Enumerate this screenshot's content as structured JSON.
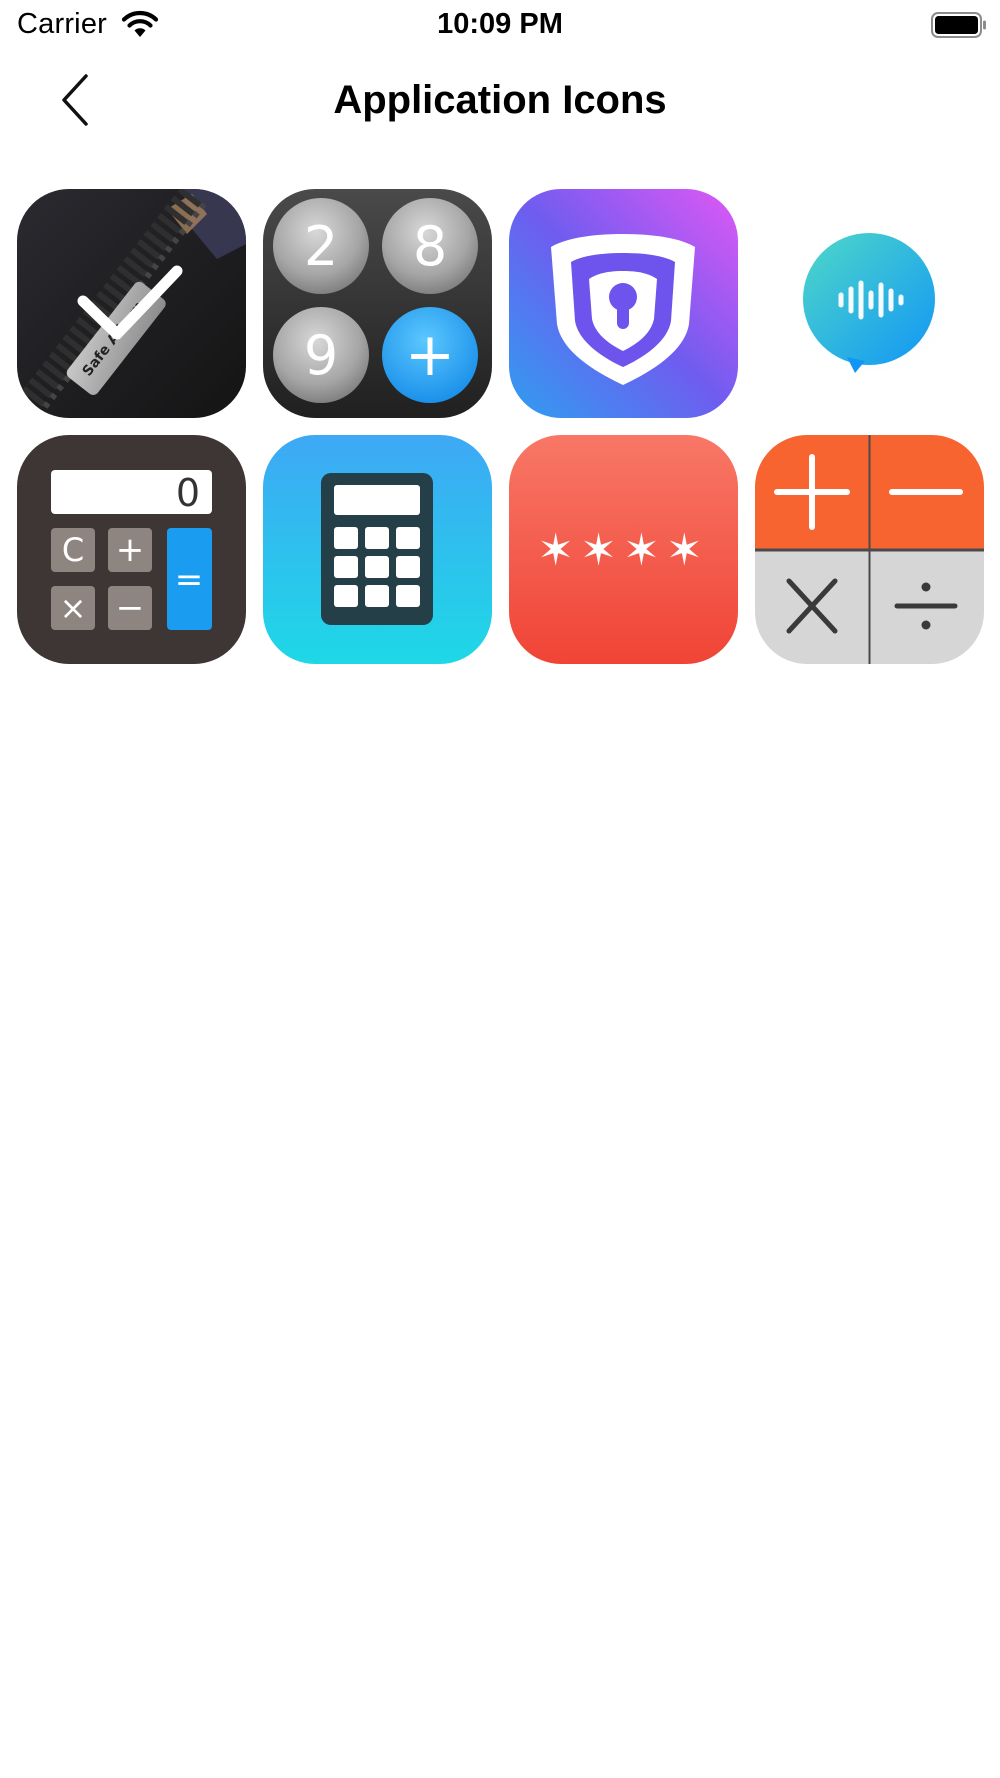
{
  "status_bar": {
    "carrier": "Carrier",
    "time": "10:09 PM"
  },
  "nav": {
    "title": "Application Icons",
    "back_icon": "chevron-left-icon"
  },
  "icons": [
    {
      "name": "safe-album-app-icon",
      "label_text": "Safe Album",
      "selected": true
    },
    {
      "name": "number-keys-app-icon",
      "keys": [
        "2",
        "8",
        "9",
        "+"
      ]
    },
    {
      "name": "shield-lock-app-icon"
    },
    {
      "name": "voice-bubble-app-icon"
    },
    {
      "name": "calculator-display-app-icon",
      "display": "0",
      "keys": [
        "C",
        "+",
        "×",
        "−",
        "="
      ]
    },
    {
      "name": "calculator-blue-app-icon"
    },
    {
      "name": "passcode-app-icon",
      "symbols": "✶✶✶✶"
    },
    {
      "name": "math-operators-app-icon",
      "operators": [
        "+",
        "−",
        "×",
        "÷"
      ]
    }
  ],
  "colors": {
    "accent_blue": "#1e9bf0",
    "shield_purple": "#7a4ff0",
    "passcode_red": "#f0483c",
    "operator_orange": "#f76430"
  }
}
